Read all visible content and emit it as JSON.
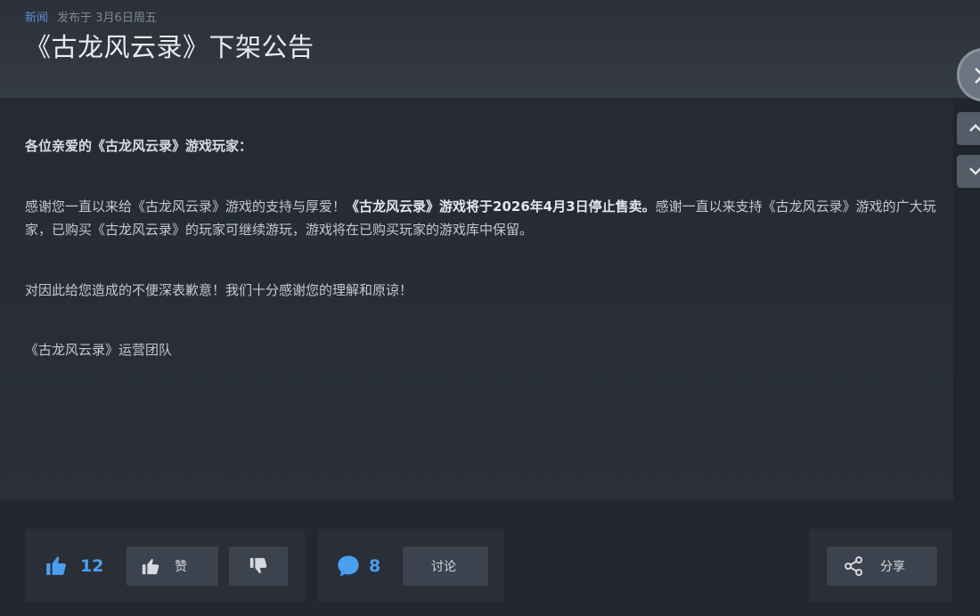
{
  "header": {
    "tag": "新闻",
    "posted": "发布于  3月6日周五",
    "title": "《古龙风云录》下架公告"
  },
  "content": {
    "greeting": "各位亲爱的《古龙风云录》游戏玩家：",
    "p2_a": "感谢您一直以来给《古龙风云录》游戏的支持与厚爱！",
    "p2_bold": "《古龙风云录》游戏将于2026年4月3日停止售卖。",
    "p2_b": "感谢一直以来支持《古龙风云录》游戏的广大玩家，已购买《古龙风云录》的玩家可继续游玩，游戏将在已购买玩家的游戏库中保留。",
    "p3": "对因此给您造成的不便深表歉意！我们十分感谢您的理解和原谅！",
    "p4": "《古龙风云录》运营团队"
  },
  "actions": {
    "like_count": "12",
    "like_label": "赞",
    "comment_count": "8",
    "discuss_label": "讨论",
    "share_label": "分享"
  },
  "colors": {
    "accent": "#4b9ff0",
    "background": "#20252e"
  },
  "icons": [
    "thumbs-up-icon",
    "thumbs-down-icon",
    "comment-icon",
    "share-icon",
    "close-icon",
    "chevron-up-icon",
    "chevron-down-icon"
  ]
}
